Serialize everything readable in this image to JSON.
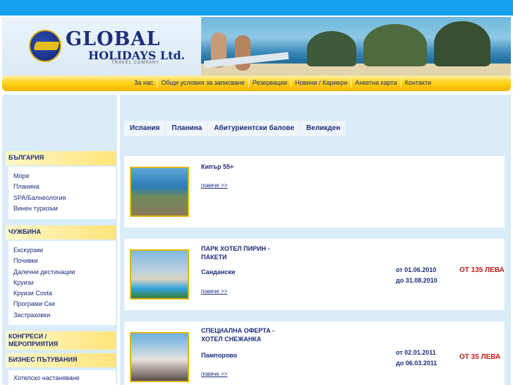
{
  "brand": {
    "name": "GLOBAL",
    "name_line2": "HOLIDAYS Ltd.",
    "tagline": "TRAVEL COMPANY"
  },
  "nav": {
    "items": [
      "За нас",
      "Общи условия за записване",
      "Резервации",
      "Новини / Кариери",
      "Анкетна карта",
      "Контакти"
    ]
  },
  "sidebar": {
    "bulgaria": {
      "heading": "БЪЛГАРИЯ",
      "items": [
        "Море",
        "Планина",
        "SPA/Балнеология",
        "Винен туризъм"
      ]
    },
    "abroad": {
      "heading": "ЧУЖБИНА",
      "items": [
        "Екскурзии",
        "Почивки",
        "Далечни дестинации",
        "Круизи",
        "Круизи Costa",
        "Програми Ски",
        "Застраховки"
      ]
    },
    "congress": {
      "heading_line1": "КОНГРЕСИ /",
      "heading_line2": "МЕРОПРИЯТИЯ"
    },
    "business": {
      "heading": "БИЗНЕС ПЪТУВАНИЯ",
      "items": [
        "Хотелско настаняване"
      ]
    }
  },
  "tabs": [
    "Испания",
    "Планина",
    "Абитуриентски балове",
    "Великден"
  ],
  "offers": [
    {
      "title": "Кипър 55+",
      "place": "",
      "more": "повече >>",
      "date_from": "",
      "date_to": "",
      "price": ""
    },
    {
      "title": "ПАРК ХОТЕЛ ПИРИН - ПАКЕТИ",
      "place": "Сандански",
      "more": "повече >>",
      "date_from": "от 01.06.2010",
      "date_to": "до 31.08.2010",
      "price": "ОТ 135 ЛЕВА"
    },
    {
      "title": "СПЕЦИАЛНА ОФЕРТА - ХОТЕЛ СНЕЖАНКА",
      "place": "Пампорово",
      "more": "повече >>",
      "date_from": "от 02.01.2011",
      "date_to": "до 06.03.2011",
      "price": "ОТ 35 ЛЕВА"
    }
  ],
  "colors": {
    "topbar": "#16a2ee",
    "nav_gold": "#ffd21a",
    "panel_blue": "#d9ecf8",
    "text_navy": "#1b2c7a",
    "price_red": "#c01818"
  }
}
